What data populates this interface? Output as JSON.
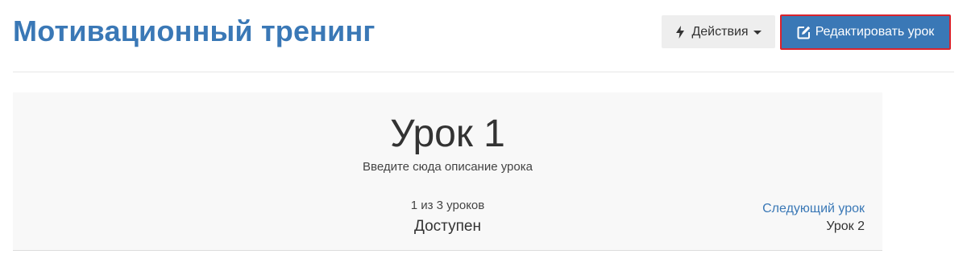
{
  "header": {
    "title": "Мотивационный тренинг",
    "actions_label": "Действия",
    "actions_icon": "bolt-icon",
    "edit_label": "Редактировать урок",
    "edit_icon": "edit-icon"
  },
  "lesson": {
    "title": "Урок 1",
    "description": "Введите сюда описание урока",
    "progress": "1 из 3 уроков",
    "status": "Доступен",
    "next_link": "Следующий урок",
    "next_name": "Урок 2"
  },
  "colors": {
    "brand": "#3a78b6",
    "highlight_border": "#d9232d",
    "panel_bg": "#f8f8f8",
    "actions_bg": "#eeeeee"
  }
}
